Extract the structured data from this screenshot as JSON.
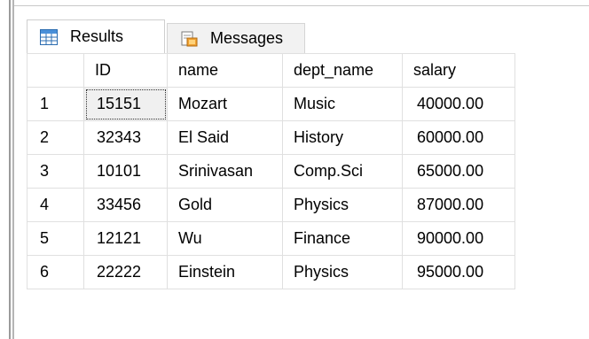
{
  "tabs": {
    "results_label": "Results",
    "messages_label": "Messages"
  },
  "icons": {
    "results": "grid-icon",
    "messages": "messages-icon"
  },
  "grid": {
    "columns": [
      "ID",
      "name",
      "dept_name",
      "salary"
    ],
    "rows": [
      {
        "num": "1",
        "id": "15151",
        "name": "Mozart",
        "dept_name": "Music",
        "salary": "40000.00"
      },
      {
        "num": "2",
        "id": "32343",
        "name": "El Said",
        "dept_name": "History",
        "salary": "60000.00"
      },
      {
        "num": "3",
        "id": "10101",
        "name": "Srinivasan",
        "dept_name": "Comp.Sci",
        "salary": "65000.00"
      },
      {
        "num": "4",
        "id": "33456",
        "name": "Gold",
        "dept_name": "Physics",
        "salary": "87000.00"
      },
      {
        "num": "5",
        "id": "12121",
        "name": "Wu",
        "dept_name": "Finance",
        "salary": "90000.00"
      },
      {
        "num": "6",
        "id": "22222",
        "name": "Einstein",
        "dept_name": "Physics",
        "salary": "95000.00"
      }
    ]
  },
  "colors": {
    "grid_line": "#e0e0e0",
    "tab_border": "#cfcfcf",
    "selected_cell_bg": "#f0f0f0"
  }
}
